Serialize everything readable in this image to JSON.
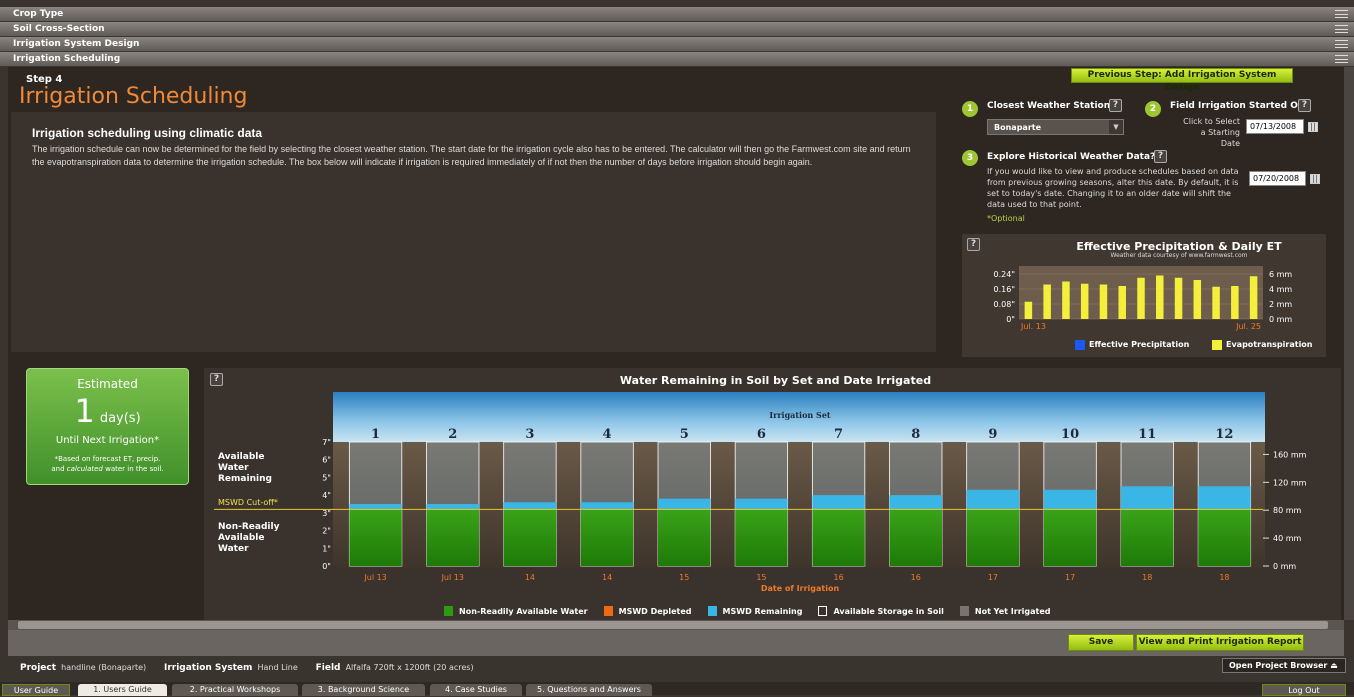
{
  "accordion": [
    "Crop Type",
    "Soil Cross-Section",
    "Irrigation System Design",
    "Irrigation Scheduling"
  ],
  "header": {
    "step": "Step 4",
    "title": "Irrigation Scheduling",
    "prev_button": "Previous Step: Add Irrigation System Design"
  },
  "intro": {
    "heading": "Irrigation scheduling using climatic data",
    "body": "The irrigation schedule can now be determined for the field by selecting the closest weather station. The start date for the irrigation cycle also has to be entered. The calculator will then go the Farmwest.com site and return the evapotranspiration data to determine the irrigation schedule. The box below will indicate if irrigation is required immediately of if not then the number of days before irrigation should begin again."
  },
  "station": {
    "num": "1",
    "label": "Closest Weather Station",
    "value": "Bonaparte"
  },
  "start": {
    "num": "2",
    "label": "Field Irrigation Started On",
    "hint_line1": "Click to Select",
    "hint_line2": "a Starting Date",
    "date": "07/13/2008"
  },
  "history": {
    "num": "3",
    "label": "Explore Historical Weather Data?*",
    "text": "If you would like to view and produce schedules based on data from previous growing seasons, alter this date. By default, it is set to today's date. Changing it to an older date will shift the data used to that point.",
    "optional": "*Optional",
    "date": "07/20/2008"
  },
  "help_glyph": "?",
  "et_chart": {
    "title": "Effective Precipitation & Daily ET",
    "subtitle": "Weather data courtesy of www.farmwest.com",
    "left_ticks": [
      "0.24\"",
      "0.16\"",
      "0.08\"",
      "0\""
    ],
    "right_ticks": [
      "6 mm",
      "4 mm",
      "2 mm",
      "0 mm"
    ],
    "x_start": "Jul. 13",
    "x_end": "Jul. 25",
    "legend": [
      "Effective Precipitation",
      "Evapotranspiration"
    ]
  },
  "estimate": {
    "label": "Estimated",
    "value": "1",
    "unit": "day(s)",
    "until": "Until Next Irrigation*",
    "note1": "*Based on forecast ET, precip.",
    "note2_a": "and ",
    "note2_em": "calculated",
    "note2_b": " water in the soil."
  },
  "water_chart": {
    "title": "Water Remaining in Soil by Set and Date Irrigated",
    "set_label": "Irrigation Set",
    "date_axis": "Date of Irrigation",
    "cutoff_label": "MSWD Cut-off*",
    "left_labels": {
      "available": "Available Water Remaining",
      "nonready": "Non-Readily Available Water"
    },
    "left_ticks": [
      "7\"",
      "6\"",
      "5\"",
      "4\"",
      "3\"",
      "2\"",
      "1\"",
      "0\""
    ],
    "right_ticks": [
      "160 mm",
      "120 mm",
      "80 mm",
      "40 mm",
      "0 mm"
    ],
    "legend": [
      "Non-Readily Available Water",
      "MSWD Depleted",
      "MSWD Remaining",
      "Available Storage in Soil",
      "Not Yet Irrigated"
    ],
    "colors": {
      "nonready": "#2e9a10",
      "depleted": "#f06a16",
      "remaining": "#3ab6e6",
      "storage": "#ffffff",
      "notyet": "#7a726c"
    }
  },
  "chart_data": [
    {
      "type": "bar",
      "title": "Effective Precipitation & Daily ET",
      "x": [
        "Jul. 13",
        "",
        "",
        "",
        "",
        "",
        "",
        "",
        "",
        "",
        "",
        "",
        "Jul. 25"
      ],
      "series": [
        {
          "name": "Effective Precipitation",
          "values": [
            0,
            0,
            0,
            0,
            0,
            0,
            0,
            0,
            0,
            0,
            0,
            0,
            0
          ]
        },
        {
          "name": "Evapotranspiration",
          "values": [
            2.3,
            4.6,
            5.0,
            4.7,
            4.6,
            4.4,
            5.5,
            5.8,
            5.5,
            5.2,
            4.3,
            4.4,
            5.7
          ]
        }
      ],
      "ylim_left": [
        0,
        0.24
      ],
      "ylim_right_mm": [
        0,
        6
      ],
      "legend": "bottom"
    },
    {
      "type": "bar",
      "title": "Water Remaining in Soil by Set and Date Irrigated",
      "xlabel": "Date of Irrigation",
      "categories": [
        "1",
        "2",
        "3",
        "4",
        "5",
        "6",
        "7",
        "8",
        "9",
        "10",
        "11",
        "12"
      ],
      "dates": [
        "Jul 13",
        "Jul 13",
        "14",
        "14",
        "15",
        "15",
        "16",
        "16",
        "17",
        "17",
        "18",
        "18"
      ],
      "ylim": [
        0,
        7
      ],
      "cutoff": 3.2,
      "total_storage": 7,
      "series": [
        {
          "name": "Non-Readily Available Water",
          "values": [
            3.2,
            3.2,
            3.2,
            3.2,
            3.2,
            3.2,
            3.2,
            3.2,
            3.2,
            3.2,
            3.2,
            3.2
          ]
        },
        {
          "name": "MSWD Remaining",
          "values": [
            0.3,
            0.3,
            0.4,
            0.4,
            0.6,
            0.6,
            0.8,
            0.8,
            1.1,
            1.1,
            1.3,
            1.3
          ]
        }
      ]
    }
  ],
  "actions": {
    "save": "Save",
    "report": "View and Print Irrigation Report",
    "browser": "Open Project Browser",
    "logout": "Log Out"
  },
  "status": {
    "project_k": "Project",
    "project_v": "handline  (Bonaparte)",
    "sys_k": "Irrigation System",
    "sys_v": "Hand Line",
    "field_k": "Field",
    "field_v": "Alfalfa  720ft x 1200ft  (20 acres)"
  },
  "tabs": {
    "guide": "User Guide",
    "items": [
      "1. Users Guide",
      "2. Practical Workshops",
      "3. Background Science",
      "4. Case Studies",
      "5. Questions and Answers"
    ]
  }
}
